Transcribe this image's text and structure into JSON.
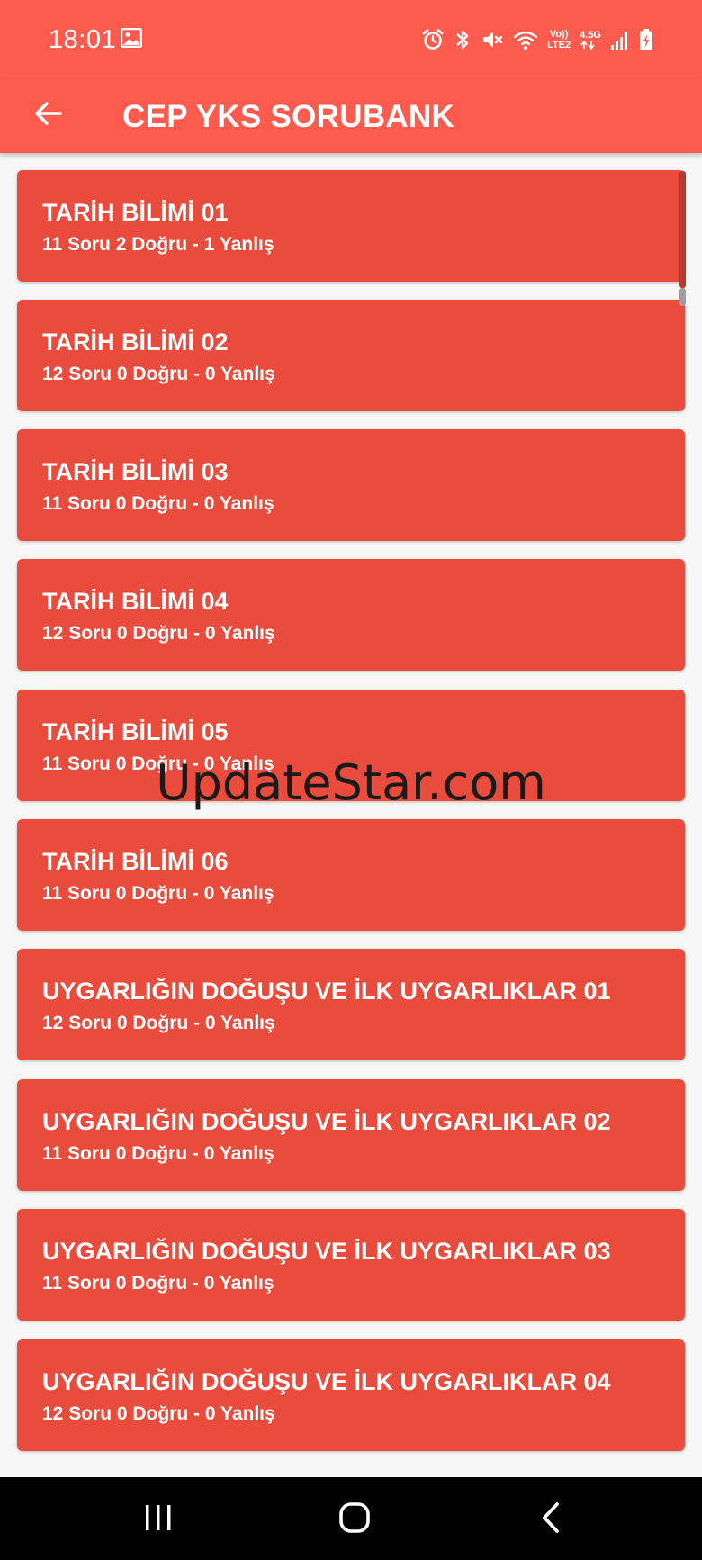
{
  "status_bar": {
    "time": "18:01",
    "network_top": "Vo))",
    "network_bottom": "LTE2",
    "signal_type": "4.5G"
  },
  "app_bar": {
    "title": "CEP YKS SORUBANK"
  },
  "items": [
    {
      "title": "TARİH BİLİMİ 01",
      "subtitle": "11 Soru 2 Doğru - 1 Yanlış"
    },
    {
      "title": "TARİH BİLİMİ 02",
      "subtitle": "12 Soru 0 Doğru - 0 Yanlış"
    },
    {
      "title": "TARİH BİLİMİ 03",
      "subtitle": "11 Soru 0 Doğru - 0 Yanlış"
    },
    {
      "title": "TARİH BİLİMİ 04",
      "subtitle": "12 Soru 0 Doğru - 0 Yanlış"
    },
    {
      "title": "TARİH BİLİMİ 05",
      "subtitle": "11 Soru 0 Doğru - 0 Yanlış"
    },
    {
      "title": "TARİH BİLİMİ 06",
      "subtitle": "11 Soru 0 Doğru - 0 Yanlış"
    },
    {
      "title": "UYGARLIĞIN DOĞUŞU VE İLK UYGARLIKLAR 01",
      "subtitle": "12 Soru 0 Doğru - 0 Yanlış"
    },
    {
      "title": "UYGARLIĞIN DOĞUŞU VE İLK UYGARLIKLAR 02",
      "subtitle": "11 Soru 0 Doğru - 0 Yanlış"
    },
    {
      "title": "UYGARLIĞIN DOĞUŞU VE İLK UYGARLIKLAR 03",
      "subtitle": "11 Soru 0 Doğru - 0 Yanlış"
    },
    {
      "title": "UYGARLIĞIN DOĞUŞU VE İLK UYGARLIKLAR 04",
      "subtitle": "12 Soru 0 Doğru - 0 Yanlış"
    }
  ],
  "watermark": "UpdateStar.com",
  "colors": {
    "app_bar": "#fe5b4f",
    "card": "#e94b3d",
    "background": "#f7f7f7",
    "nav_bar": "#000000"
  },
  "icons": {
    "back": "arrow-back-icon",
    "nav_recents": "recents-icon",
    "nav_home": "home-icon",
    "nav_back": "nav-back-icon"
  }
}
